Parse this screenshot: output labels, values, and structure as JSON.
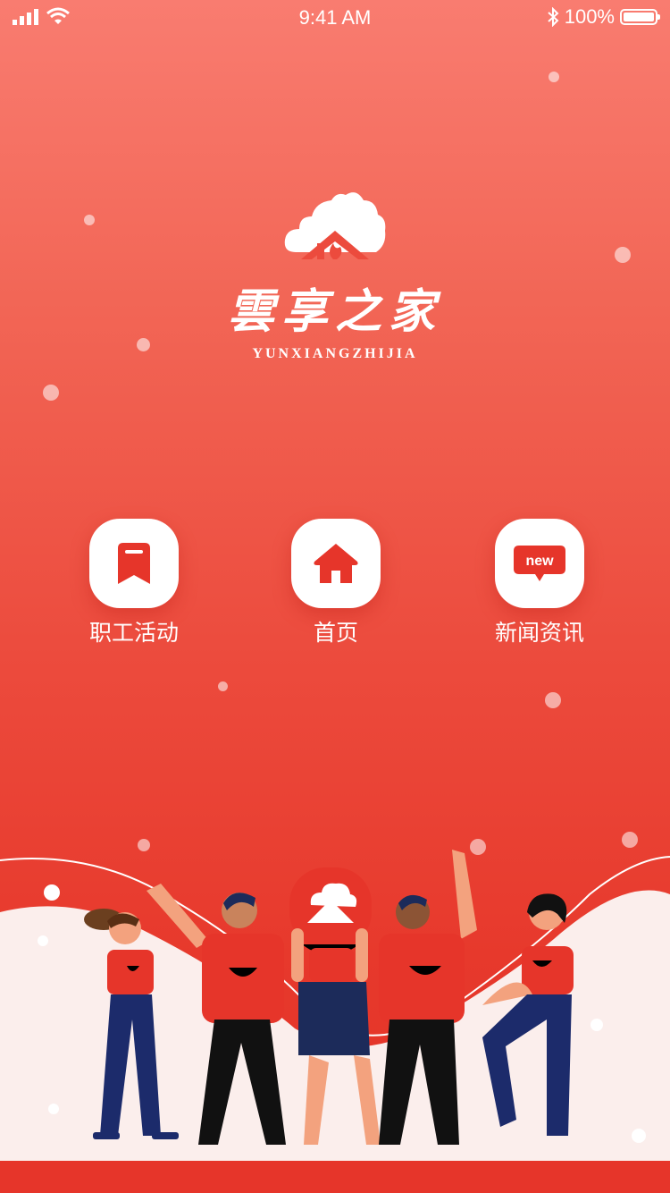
{
  "status_bar": {
    "time": "9:41 AM",
    "battery": "100%",
    "battery_level": 1.0
  },
  "logo": {
    "title_cn": "雲享之家",
    "title_en": "YUNXIANGZHIJIA"
  },
  "menu": {
    "items": [
      {
        "label": "职工活动",
        "icon": "bookmark-icon"
      },
      {
        "label": "首页",
        "icon": "home-icon"
      },
      {
        "label": "新闻资讯",
        "icon": "news-icon"
      }
    ],
    "news_badge": "new"
  },
  "colors": {
    "accent": "#e6352a",
    "gradient_top": "#f97c70",
    "gradient_bottom": "#e23227",
    "tile_background": "#ffffff"
  }
}
